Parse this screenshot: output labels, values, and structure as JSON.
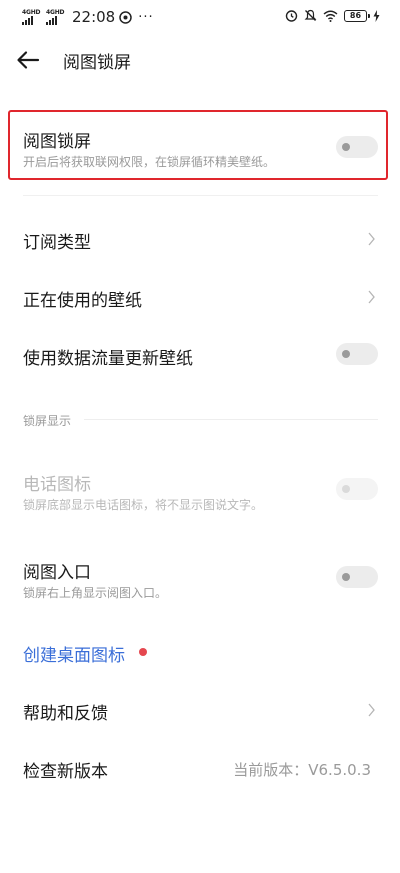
{
  "status_bar": {
    "signal1_label": "4GHD",
    "signal2_label": "4GHD",
    "time": "22:08",
    "more": "···",
    "battery_level": "86"
  },
  "header": {
    "title": "阅图锁屏"
  },
  "lock_screen_toggle": {
    "title": "阅图锁屏",
    "subtitle": "开启后将获取联网权限，在锁屏循环精美壁纸。",
    "enabled": false
  },
  "menu": {
    "subscription_type": "订阅类型",
    "wallpaper_in_use": "正在使用的壁纸",
    "mobile_data_update": "使用数据流量更新壁纸"
  },
  "section": {
    "lock_display_label": "锁屏显示"
  },
  "phone_icon": {
    "title": "电话图标",
    "subtitle": "锁屏底部显示电话图标，将不显示图说文字。",
    "enabled": false,
    "disabled": true
  },
  "entry": {
    "title": "阅图入口",
    "subtitle": "锁屏右上角显示阅图入口。",
    "enabled": false
  },
  "create_shortcut": {
    "label": "创建桌面图标",
    "badge_color": "#e5474f"
  },
  "help": {
    "label": "帮助和反馈"
  },
  "update": {
    "label": "检查新版本",
    "version": "当前版本：V6.5.0.3"
  },
  "colors": {
    "highlight_border": "#e0262d",
    "link": "#3a6ed8"
  }
}
